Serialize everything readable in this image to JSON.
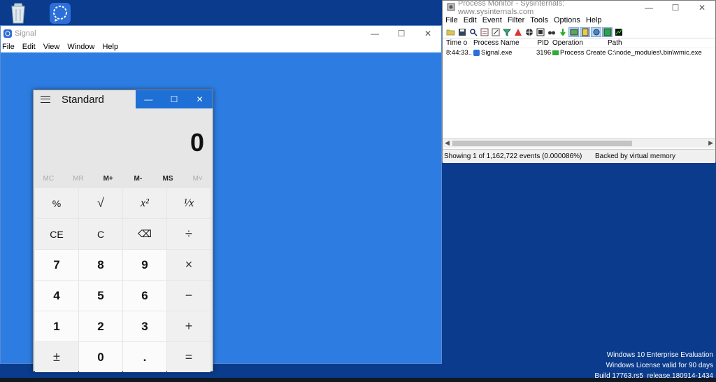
{
  "desktop": {
    "icons": [
      {
        "name": "recycle-bin-icon"
      },
      {
        "name": "signal-icon"
      }
    ]
  },
  "signal_window": {
    "title": "Signal",
    "menu": [
      "File",
      "Edit",
      "View",
      "Window",
      "Help"
    ],
    "controls": {
      "minimize": "—",
      "maximize": "☐",
      "close": "✕"
    },
    "background_color": "#2c7ce1"
  },
  "calculator": {
    "mode": "Standard",
    "display": "0",
    "controls": {
      "minimize": "—",
      "maximize": "☐",
      "close": "✕"
    },
    "memory": [
      "MC",
      "MR",
      "M+",
      "M-",
      "MS",
      "M˅"
    ],
    "keys": [
      [
        "%",
        "√",
        "x²",
        "¹⁄x"
      ],
      [
        "CE",
        "C",
        "⌫",
        "÷"
      ],
      [
        "7",
        "8",
        "9",
        "×"
      ],
      [
        "4",
        "5",
        "6",
        "−"
      ],
      [
        "1",
        "2",
        "3",
        "+"
      ],
      [
        "±",
        "0",
        ".",
        "="
      ]
    ],
    "accent_color": "#1e6fd6"
  },
  "procmon": {
    "title": "Process Monitor - Sysinternals: www.sysinternals.com",
    "menu": [
      "File",
      "Edit",
      "Event",
      "Filter",
      "Tools",
      "Options",
      "Help"
    ],
    "controls": {
      "minimize": "—",
      "maximize": "☐",
      "close": "✕"
    },
    "columns": [
      "Time o",
      "Process Name",
      "PID",
      "Operation",
      "Path"
    ],
    "rows": [
      {
        "time": "8:44:33....",
        "process": "Signal.exe",
        "pid": "3196",
        "operation": "Process Create",
        "path": "C:\\node_modules\\.bin\\wmic.exe"
      }
    ],
    "status_events": "Showing 1 of 1,162,722 events (0.000086%)",
    "status_memory": "Backed by virtual memory"
  },
  "watermark": {
    "line1": "Windows 10 Enterprise Evaluation",
    "line2": "Windows License valid for 90 days",
    "line3": "Build 17763.rs5_release.180914-1434"
  }
}
